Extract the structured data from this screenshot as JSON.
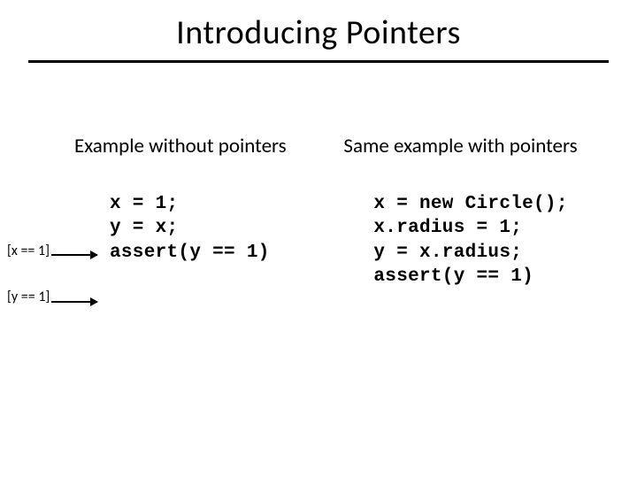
{
  "title": "Introducing Pointers",
  "left": {
    "heading": "Example without pointers",
    "annotation1": "[x == 1]",
    "annotation2": "[y == 1]",
    "code": "x = 1;\ny = x;\nassert(y == 1)"
  },
  "right": {
    "heading": "Same example with pointers",
    "code": "x = new Circle();\nx.radius = 1;\ny = x.radius;\nassert(y == 1)"
  }
}
